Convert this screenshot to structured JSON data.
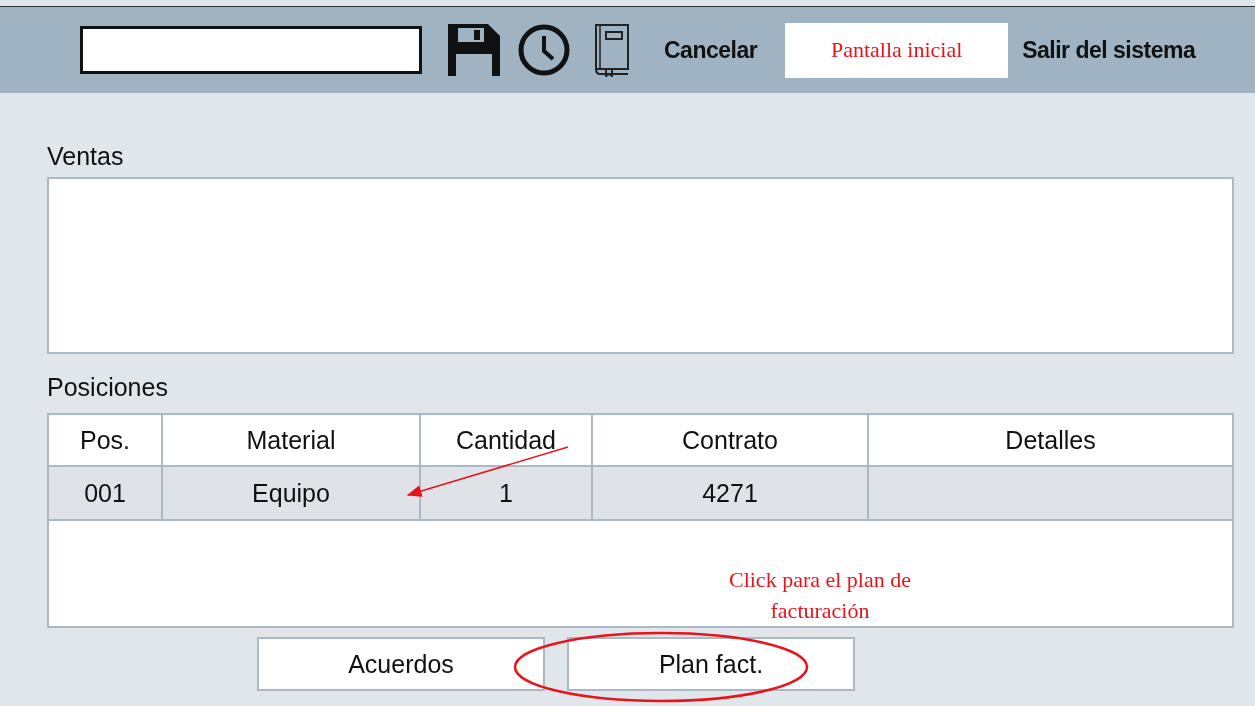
{
  "toolbar": {
    "actions": [
      {
        "label": "Cancelar",
        "kind": "link"
      },
      {
        "label": "Pantalla inicial",
        "kind": "boxed"
      },
      {
        "label": "Salir del sistema",
        "kind": "link"
      }
    ]
  },
  "ventas": {
    "title": "Ventas"
  },
  "posiciones": {
    "title": "Posiciones",
    "table": {
      "columns": [
        "Pos.",
        "Material",
        "Cantidad",
        "Contrato",
        "Detalles"
      ],
      "rows": [
        [
          "001",
          "Equipo",
          "1",
          "4271"
        ]
      ]
    }
  },
  "buttons": [
    "Acuerdos",
    "Plan fact."
  ],
  "annotation": {
    "note": "Click para el plan de facturación"
  }
}
